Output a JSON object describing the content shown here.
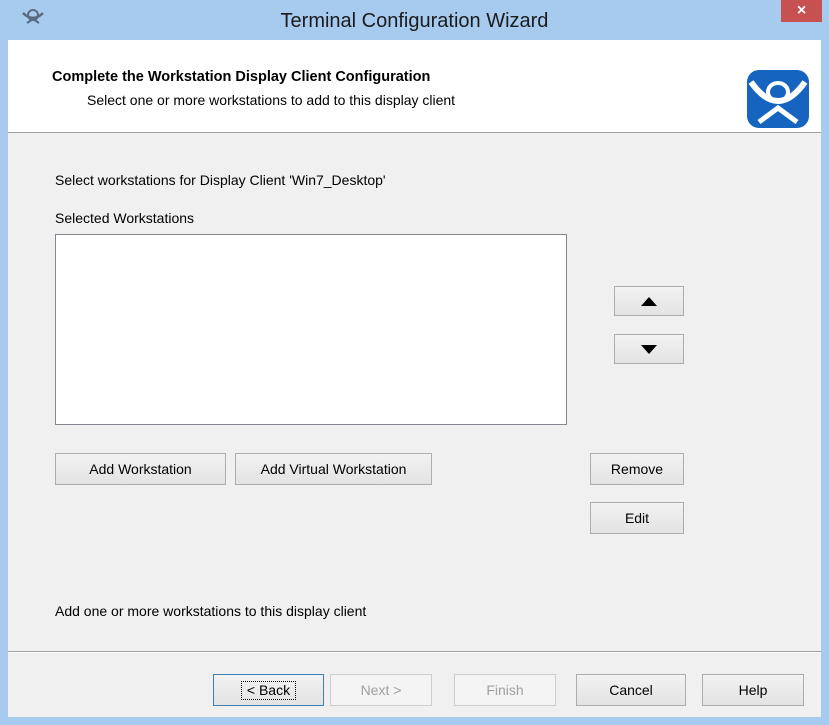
{
  "window": {
    "title": "Terminal Configuration Wizard",
    "close_glyph": "×"
  },
  "header": {
    "title": "Complete the Workstation Display Client Configuration",
    "subtitle": "Select one or more workstations to add to this display client"
  },
  "main": {
    "prompt": "Select workstations for Display Client 'Win7_Desktop'",
    "list_label": "Selected Workstations",
    "selected_workstations": [],
    "hint": "Add one or more workstations to this display client"
  },
  "buttons": {
    "add_workstation": "Add Workstation",
    "add_virtual_workstation": "Add Virtual Workstation",
    "remove": "Remove",
    "edit": "Edit"
  },
  "footer": {
    "back": "< Back",
    "next": "Next >",
    "finish": "Finish",
    "cancel": "Cancel",
    "help": "Help"
  },
  "icons": {
    "app": "thinmanager-icon",
    "logo": "thinmanager-logo-icon",
    "move_up": "arrow-up-icon",
    "move_down": "arrow-down-icon",
    "close": "close-icon"
  },
  "colors": {
    "titlebar": "#a6cbef",
    "close_button": "#c75050",
    "logo_blue": "#1565c0",
    "dialog_background": "#f0f0f0"
  }
}
